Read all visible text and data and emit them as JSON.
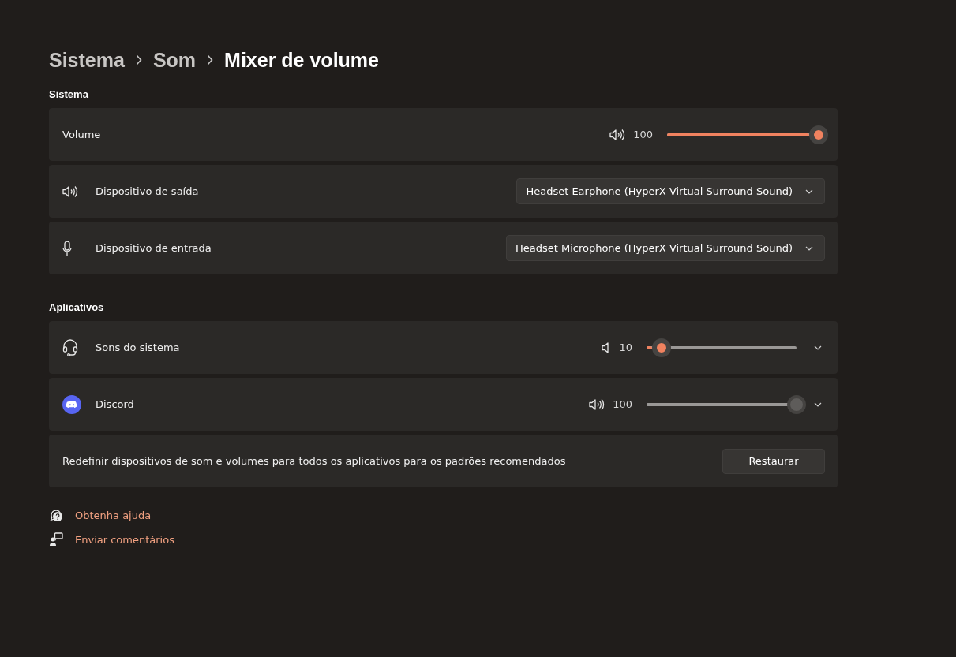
{
  "breadcrumb": [
    {
      "label": "Sistema",
      "current": false
    },
    {
      "label": "Som",
      "current": false
    },
    {
      "label": "Mixer de volume",
      "current": true
    }
  ],
  "system": {
    "title": "Sistema",
    "volume": {
      "label": "Volume",
      "reading": "100",
      "level": 1.0
    },
    "devices": [
      {
        "kind": "speaker",
        "label": "Dispositivo de saída",
        "value": "Headset Earphone (HyperX Virtual Surround Sound)"
      },
      {
        "kind": "microphone",
        "label": "Dispositivo de entrada",
        "value": "Headset Microphone (HyperX Virtual Surround Sound)"
      }
    ]
  },
  "apps": {
    "title": "Aplicativos",
    "items": [
      {
        "kind": "headset",
        "name": "Sons do sistema",
        "reading": "10",
        "level": 0.1,
        "active": true,
        "loud": false
      },
      {
        "kind": "discord",
        "name": "Discord",
        "reading": "100",
        "level": 1.0,
        "active": false,
        "loud": true
      }
    ],
    "reset": {
      "text": "Redefinir dispositivos de som e volumes para todos os aplicativos para os padrões recomendados",
      "button": "Restaurar"
    }
  },
  "links": [
    {
      "kind": "help",
      "label": "Obtenha ajuda"
    },
    {
      "kind": "feedback",
      "label": "Enviar comentários"
    }
  ]
}
